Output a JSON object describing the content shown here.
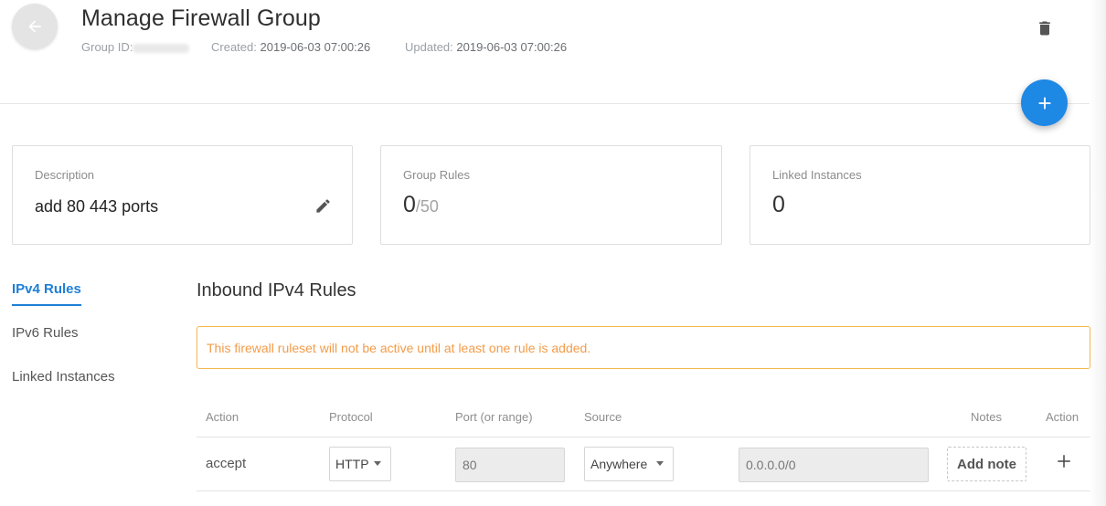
{
  "header": {
    "title": "Manage Firewall Group",
    "group_id_label": "Group ID:",
    "created_label": "Created:",
    "created_value": "2019-06-03 07:00:26",
    "updated_label": "Updated:",
    "updated_value": "2019-06-03 07:00:26",
    "back_icon": "arrow-left-icon",
    "delete_icon": "trash-icon",
    "fab_icon": "plus-icon"
  },
  "cards": {
    "description": {
      "label": "Description",
      "value": "add 80 443 ports",
      "edit_icon": "pencil-icon"
    },
    "group_rules": {
      "label": "Group Rules",
      "count": "0",
      "limit": "/50"
    },
    "linked_instances": {
      "label": "Linked Instances",
      "count": "0"
    }
  },
  "side_nav": {
    "items": [
      {
        "label": "IPv4 Rules",
        "active": true
      },
      {
        "label": "IPv6 Rules",
        "active": false
      },
      {
        "label": "Linked Instances",
        "active": false
      }
    ]
  },
  "main": {
    "section_title": "Inbound IPv4 Rules",
    "warning": "This firewall ruleset will not be active until at least one rule is added."
  },
  "rules_table": {
    "columns": [
      "Action",
      "Protocol",
      "Port (or range)",
      "Source",
      "Notes",
      "Action"
    ],
    "new_rule": {
      "action": "accept",
      "protocol": "HTTP",
      "port": "80",
      "source": "Anywhere",
      "source_cidr": "0.0.0.0/0",
      "note_button": "Add note",
      "add_icon": "plus-icon"
    }
  },
  "colors": {
    "accent": "#1e88e5",
    "active_tab": "#1e7fd6",
    "warning_border": "#f0b84d",
    "warning_text": "#f39c4a"
  }
}
